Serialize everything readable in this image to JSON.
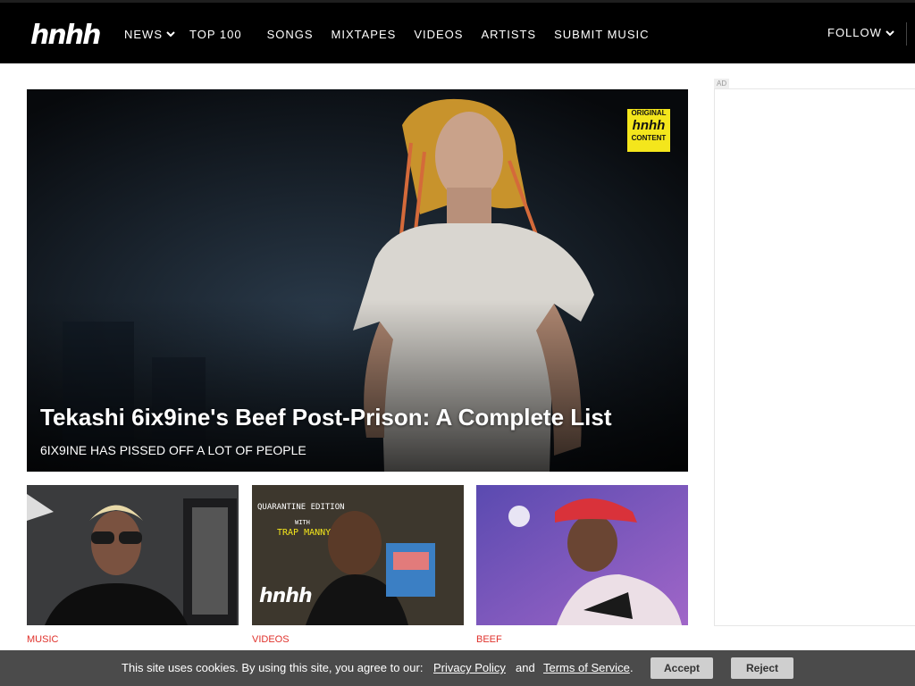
{
  "header": {
    "logo": "hnhh",
    "nav": [
      {
        "label": "NEWS",
        "dropdown": true
      },
      {
        "label": "TOP 100"
      },
      {
        "label": "SONGS"
      },
      {
        "label": "MIXTAPES"
      },
      {
        "label": "VIDEOS"
      },
      {
        "label": "ARTISTS"
      },
      {
        "label": "SUBMIT MUSIC"
      }
    ],
    "follow": "FOLLOW"
  },
  "hero": {
    "title": "Tekashi 6ix9ine's Beef Post-Prison: A Complete List",
    "subtitle": "6IX9INE HAS PISSED OFF A LOT OF PEOPLE",
    "badge": {
      "line1": "ORIGINAL",
      "logo": "hnhh",
      "line2": "CONTENT"
    }
  },
  "cards": [
    {
      "tag": "MUSIC"
    },
    {
      "tag": "VIDEOS",
      "overlay_top": "QUARANTINE EDITION",
      "overlay_with": "WITH",
      "overlay_name": "TRAP MANNY",
      "overlay_logo": "hnhh"
    },
    {
      "tag": "BEEF"
    }
  ],
  "ad": {
    "label": "AD"
  },
  "cookie": {
    "text": "This site uses cookies. By using this site, you agree to our:",
    "privacy_link": "Privacy Policy",
    "and": "and",
    "terms_link": "Terms of Service",
    "period": ".",
    "accept": "Accept",
    "reject": "Reject"
  },
  "colors": {
    "header_bg": "#000000",
    "tag_red": "#e0312b",
    "cookie_bg": "#4b4b4b",
    "button_bg": "#cfcfcf",
    "badge_yellow": "#f4e61c"
  }
}
